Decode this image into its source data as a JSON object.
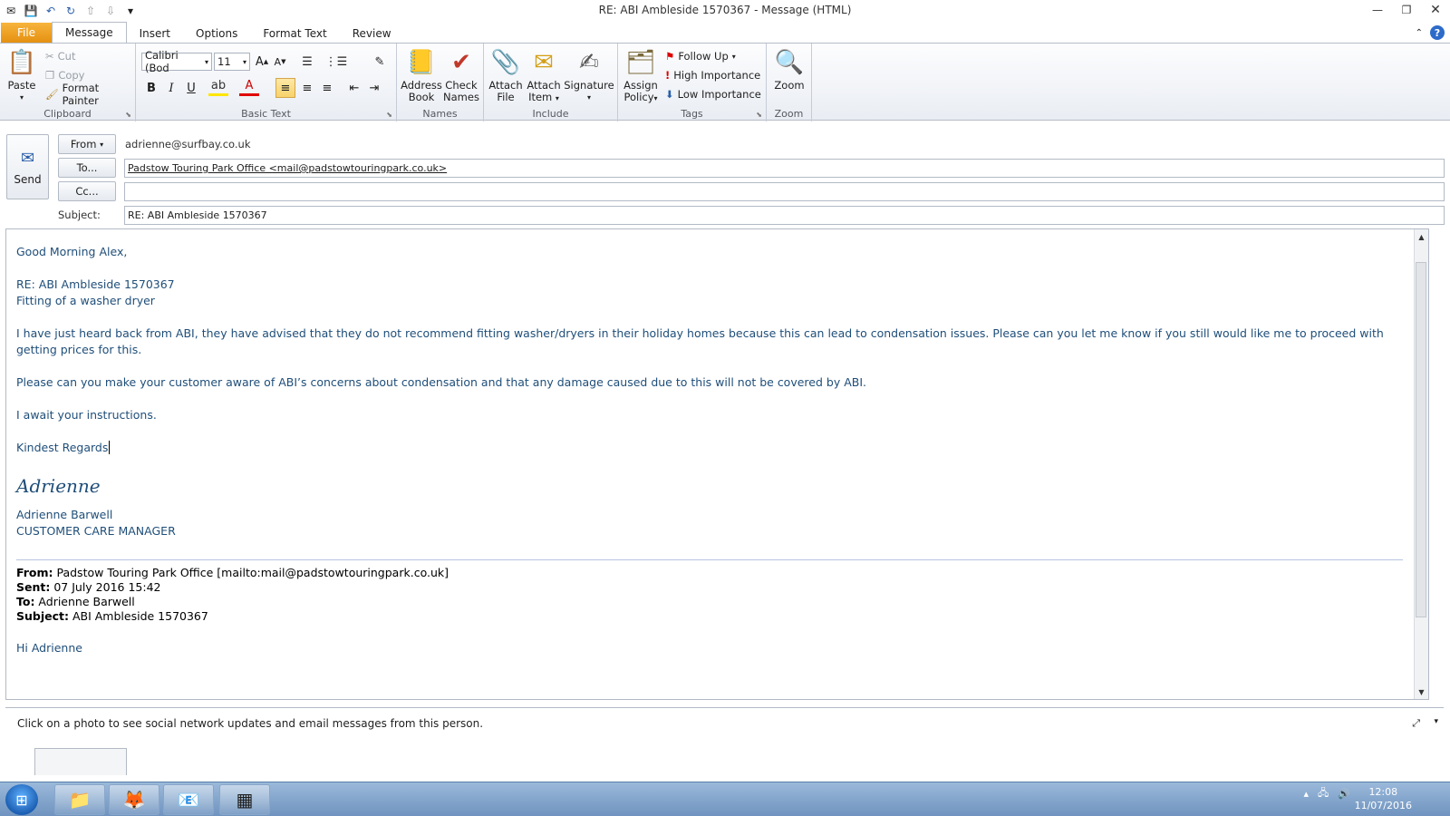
{
  "window": {
    "title": "RE: ABI Ambleside 1570367  -  Message (HTML)"
  },
  "tabs": [
    "File",
    "Message",
    "Insert",
    "Options",
    "Format Text",
    "Review"
  ],
  "ribbon": {
    "clipboard": {
      "label": "Clipboard",
      "paste": "Paste",
      "cut": "Cut",
      "copy": "Copy",
      "format_painter": "Format Painter"
    },
    "basic_text": {
      "label": "Basic Text",
      "font": "Calibri (Body)",
      "font_display": "Calibri (Bod",
      "size": "11"
    },
    "names": {
      "label": "Names",
      "address_book": "Address Book",
      "address_book_l1": "Address",
      "address_book_l2": "Book",
      "check_names_l1": "Check",
      "check_names_l2": "Names"
    },
    "include": {
      "label": "Include",
      "attach_file_l1": "Attach",
      "attach_file_l2": "File",
      "attach_item_l1": "Attach",
      "attach_item_l2": "Item",
      "signature": "Signature"
    },
    "tags": {
      "label": "Tags",
      "assign_policy_l1": "Assign",
      "assign_policy_l2": "Policy",
      "follow_up": "Follow Up",
      "high_importance": "High Importance",
      "low_importance": "Low Importance"
    },
    "zoom": {
      "label": "Zoom",
      "zoom": "Zoom"
    }
  },
  "header": {
    "send": "Send",
    "from_btn": "From",
    "from_value": "adrienne@surfbay.co.uk",
    "to_btn": "To...",
    "to_value": "Padstow Touring Park Office <mail@padstowtouringpark.co.uk>",
    "cc_btn": "Cc...",
    "cc_value": "",
    "subject_label": "Subject:",
    "subject_value": "RE: ABI Ambleside 1570367"
  },
  "body": {
    "greeting": "Good Morning Alex,",
    "re_line": "RE: ABI Ambleside 1570367",
    "fitting": "Fitting of a washer dryer",
    "para1": "I have just heard back from ABI, they have advised that they do not recommend fitting washer/dryers in their holiday homes because this can lead to condensation issues.    Please can you let me know if you still would like me to proceed with getting prices for this.",
    "para2": "Please can you make your customer aware of ABI’s concerns about condensation and that any damage caused due to this will not be covered by ABI.",
    "para3": "I await your instructions.",
    "closing": "Kindest Regards",
    "signature_script": "Adrienne",
    "sig_name": "Adrienne Barwell",
    "sig_title": "CUSTOMER CARE MANAGER",
    "q_from_label": "From:",
    "q_from": " Padstow Touring Park Office [mailto:mail@padstowtouringpark.co.uk]",
    "q_sent_label": "Sent:",
    "q_sent": " 07 July 2016 15:42",
    "q_to_label": "To:",
    "q_to": " Adrienne Barwell",
    "q_subject_label": "Subject:",
    "q_subject": " ABI Ambleside 1570367",
    "q_hi": "Hi Adrienne"
  },
  "social": {
    "text": "Click on a photo to see social network updates and email messages from this person."
  },
  "taskbar": {
    "time": "12:08",
    "date": "11/07/2016"
  }
}
